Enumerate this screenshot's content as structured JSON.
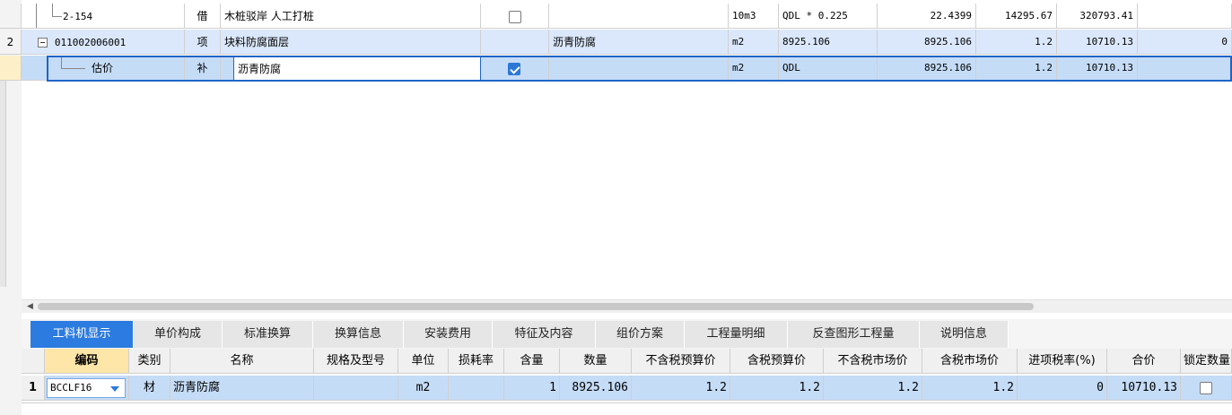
{
  "upper": {
    "rows": [
      {
        "row_num": "",
        "code": "2-154",
        "type": "借",
        "name": "木桩驳岸 人工打桩",
        "checked": false,
        "spec": "",
        "unit": "10m3",
        "expr": "QDL * 0.225",
        "qty": "22.4399",
        "price": "14295.67",
        "total": "320793.41",
        "extra": ""
      },
      {
        "row_num": "2",
        "code": "011002006001",
        "type": "项",
        "name": "块料防腐面层",
        "checked": null,
        "spec": "沥青防腐",
        "unit": "m2",
        "expr": "8925.106",
        "qty": "8925.106",
        "price": "1.2",
        "total": "10710.13",
        "extra": "0"
      },
      {
        "row_num": "",
        "code": "估价",
        "type": "补",
        "name": "沥青防腐",
        "checked": true,
        "spec": "",
        "unit": "m2",
        "expr": "QDL",
        "qty": "8925.106",
        "price": "1.2",
        "total": "10710.13",
        "extra": ""
      }
    ]
  },
  "tabs": [
    {
      "label": "工料机显示",
      "active": true
    },
    {
      "label": "单价构成",
      "active": false
    },
    {
      "label": "标准换算",
      "active": false
    },
    {
      "label": "换算信息",
      "active": false
    },
    {
      "label": "安装费用",
      "active": false
    },
    {
      "label": "特征及内容",
      "active": false
    },
    {
      "label": "组价方案",
      "active": false
    },
    {
      "label": "工程量明细",
      "active": false
    },
    {
      "label": "反查图形工程量",
      "active": false
    },
    {
      "label": "说明信息",
      "active": false
    }
  ],
  "lower": {
    "headers": [
      "编码",
      "类别",
      "名称",
      "规格及型号",
      "单位",
      "损耗率",
      "含量",
      "数量",
      "不含税预算价",
      "含税预算价",
      "不含税市场价",
      "含税市场价",
      "进项税率(%)",
      "合价",
      "锁定数量"
    ],
    "row": {
      "num": "1",
      "code": "BCCLF16",
      "category": "材",
      "name": "沥青防腐",
      "spec": "",
      "unit": "m2",
      "loss": "",
      "content": "1",
      "qty": "8925.106",
      "pre_tax_budget": "1.2",
      "tax_budget": "1.2",
      "pre_tax_market": "1.2",
      "tax_market": "1.2",
      "tax_rate": "0",
      "total": "10710.13"
    }
  },
  "colors": {
    "accent": "#2b7be0",
    "row_highlight": "#c5dcf7",
    "row_alt": "#dbe8fb",
    "sort_header": "#fde6a8"
  }
}
